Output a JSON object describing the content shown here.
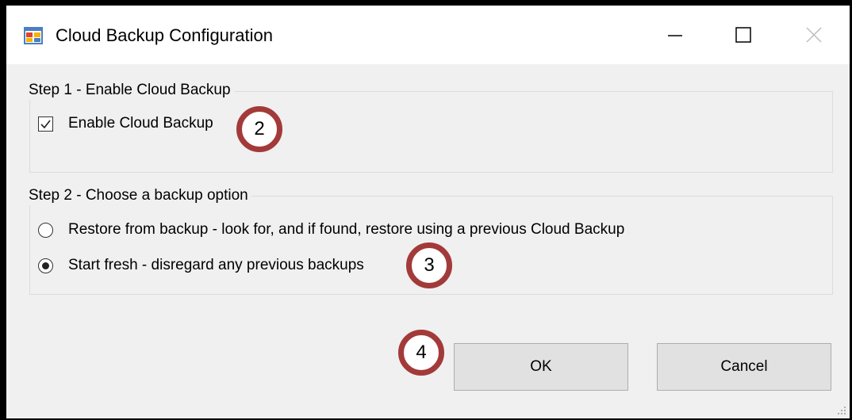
{
  "window": {
    "title": "Cloud Backup Configuration",
    "app_icon": "form-app-icon",
    "controls": {
      "minimize": "minimize-icon",
      "maximize": "maximize-icon",
      "close": "close-icon"
    }
  },
  "step1": {
    "title": "Step 1 - Enable Cloud Backup",
    "checkbox": {
      "label": "Enable Cloud Backup",
      "checked": true
    }
  },
  "step2": {
    "title": "Step 2 - Choose a backup option",
    "options": [
      {
        "label": "Restore from backup - look for, and if found, restore using a previous Cloud Backup",
        "selected": false
      },
      {
        "label": "Start fresh - disregard any previous backups",
        "selected": true
      }
    ]
  },
  "buttons": {
    "ok": "OK",
    "cancel": "Cancel"
  },
  "annotations": [
    "2",
    "3",
    "4"
  ],
  "colors": {
    "marker_ring": "#a33a3a",
    "dialog_bg": "#f0f0f0",
    "button_bg": "#e1e1e1"
  }
}
